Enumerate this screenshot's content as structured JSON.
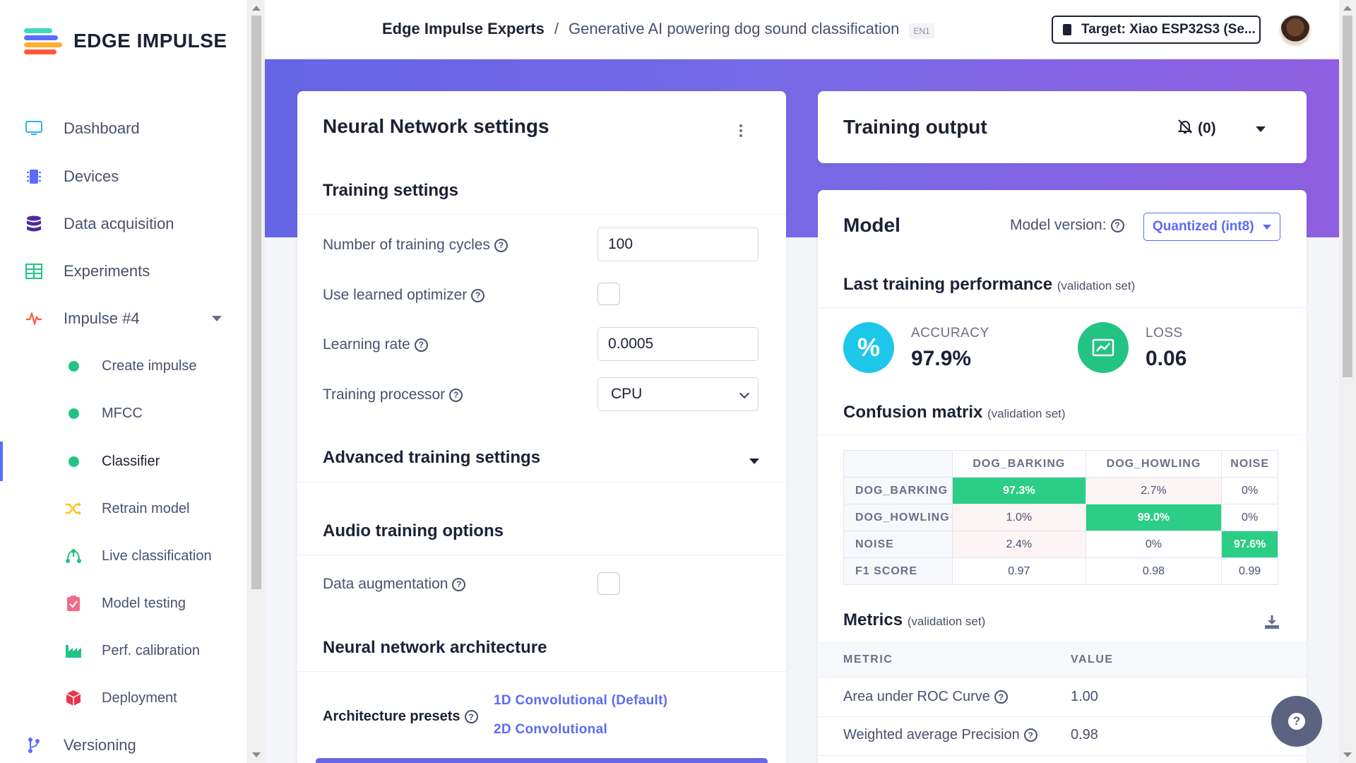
{
  "brand": {
    "name": "EDGE IMPULSE",
    "colors": [
      "#3dd9c1",
      "#5b6cff",
      "#ff5a3c",
      "#ffb02e"
    ]
  },
  "sidebar": {
    "items": [
      {
        "label": "Dashboard",
        "icon": "monitor-icon",
        "color": "#2ab7e0"
      },
      {
        "label": "Devices",
        "icon": "chip-icon",
        "color": "#5b6cff"
      },
      {
        "label": "Data acquisition",
        "icon": "database-icon",
        "color": "#4b2a9e"
      },
      {
        "label": "Experiments",
        "icon": "grid-icon",
        "color": "#23c483"
      },
      {
        "label": "Impulse #4",
        "icon": "pulse-icon",
        "color": "#ff5a3c"
      }
    ],
    "sub_items": [
      {
        "label": "Create impulse",
        "icon": "dot-icon"
      },
      {
        "label": "MFCC",
        "icon": "dot-icon"
      },
      {
        "label": "Classifier",
        "icon": "dot-icon",
        "active": true
      },
      {
        "label": "Retrain model",
        "icon": "shuffle-icon",
        "color": "#ffc21a"
      },
      {
        "label": "Live classification",
        "icon": "nodes-icon",
        "color": "#23c483"
      },
      {
        "label": "Model testing",
        "icon": "clipboard-check-icon",
        "color": "#f06a8a"
      },
      {
        "label": "Perf. calibration",
        "icon": "factory-icon",
        "color": "#23c483"
      },
      {
        "label": "Deployment",
        "icon": "cube-icon",
        "color": "#e8344e"
      }
    ],
    "bottom_items": [
      {
        "label": "Versioning",
        "icon": "branch-icon",
        "color": "#5b6cff"
      }
    ]
  },
  "header": {
    "project": "Edge Impulse Experts",
    "separator": "/",
    "page": "Generative AI powering dog sound classification",
    "tag": "EN1",
    "target": "Target: Xiao ESP32S3 (Se..."
  },
  "nn_settings": {
    "title": "Neural Network settings",
    "training_settings_title": "Training settings",
    "fields": {
      "cycles_label": "Number of training cycles",
      "cycles_value": "100",
      "optimizer_label": "Use learned optimizer",
      "lr_label": "Learning rate",
      "lr_value": "0.0005",
      "processor_label": "Training processor",
      "processor_value": "CPU"
    },
    "advanced_title": "Advanced training settings",
    "audio_title": "Audio training options",
    "augmentation_label": "Data augmentation",
    "architecture_title": "Neural network architecture",
    "presets_label": "Architecture presets",
    "presets": [
      "1D Convolutional (Default)",
      "2D Convolutional"
    ]
  },
  "training_output": {
    "title": "Training output",
    "notifications": "(0)"
  },
  "model": {
    "title": "Model",
    "version_label": "Model version:",
    "version_value": "Quantized (int8)",
    "perf_title": "Last training performance",
    "perf_sub": "(validation set)",
    "accuracy_label": "ACCURACY",
    "accuracy_value": "97.9%",
    "accuracy_symbol": "%",
    "loss_label": "LOSS",
    "loss_value": "0.06",
    "cm_title": "Confusion matrix",
    "cm_sub": "(validation set)",
    "cm_columns": [
      "DOG_BARKING",
      "DOG_HOWLING",
      "NOISE"
    ],
    "cm_rows": [
      {
        "label": "DOG_BARKING",
        "values": [
          "97.3%",
          "2.7%",
          "0%"
        ]
      },
      {
        "label": "DOG_HOWLING",
        "values": [
          "1.0%",
          "99.0%",
          "0%"
        ]
      },
      {
        "label": "NOISE",
        "values": [
          "2.4%",
          "0%",
          "97.6%"
        ]
      },
      {
        "label": "F1 SCORE",
        "values": [
          "0.97",
          "0.98",
          "0.99"
        ]
      }
    ],
    "metrics_title": "Metrics",
    "metrics_sub": "(validation set)",
    "metrics_headers": [
      "METRIC",
      "VALUE"
    ],
    "metrics_rows": [
      {
        "label": "Area under ROC Curve",
        "value": "1.00"
      },
      {
        "label": "Weighted average Precision",
        "value": "0.98"
      }
    ]
  },
  "colors": {
    "accent": "#5b6cff",
    "success": "#2ccd85",
    "accuracy": "#1dc7ea",
    "loss": "#23c483"
  }
}
